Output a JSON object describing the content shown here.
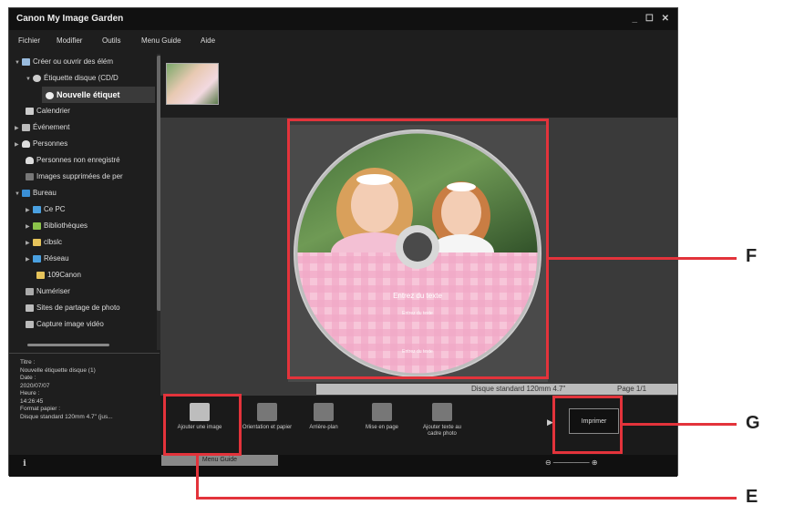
{
  "window": {
    "title": "Canon My Image Garden",
    "controls": "_ ☐ ✕"
  },
  "menu": {
    "items": [
      "Fichier",
      "Modifier",
      "Outils",
      "Menu Guide",
      "Aide"
    ]
  },
  "sidebar": {
    "items": [
      {
        "label": "Créer ou ouvrir des élém",
        "arrow": "▼"
      },
      {
        "label": "Étiquette disque (CD/D",
        "arrow": "▼"
      },
      {
        "label": "Nouvelle étiquet",
        "arrow": ""
      },
      {
        "label": "Calendrier",
        "arrow": ""
      },
      {
        "label": "Événement",
        "arrow": "▶"
      },
      {
        "label": "Personnes",
        "arrow": "▶"
      },
      {
        "label": "Personnes non enregistré",
        "arrow": ""
      },
      {
        "label": "Images supprimées de per",
        "arrow": ""
      },
      {
        "label": "Bureau",
        "arrow": "▼"
      },
      {
        "label": "Ce PC",
        "arrow": "▶"
      },
      {
        "label": "Bibliothèques",
        "arrow": "▶"
      },
      {
        "label": "clbslc",
        "arrow": "▶"
      },
      {
        "label": "Réseau",
        "arrow": "▶"
      },
      {
        "label": "109Canon",
        "arrow": ""
      },
      {
        "label": "Numériser",
        "arrow": ""
      },
      {
        "label": "Sites de partage de photo",
        "arrow": ""
      },
      {
        "label": "Capture image vidéo",
        "arrow": ""
      }
    ]
  },
  "info": {
    "lines": [
      "Titre :",
      "  Nouvelle étiquette disque (1)",
      "Date :",
      "  2020/07/07",
      "Heure :",
      "  14:26:45",
      "Format papier :",
      "  Disque standard 120mm 4.7\" (jus..."
    ]
  },
  "disc": {
    "title": "Entrez du texte",
    "subtitle": "Entrez du texte",
    "footer": "Entrez du texte"
  },
  "statusbar": {
    "paper": "Disque standard 120mm 4.7\"",
    "page": "Page 1/1"
  },
  "toolbar": {
    "items": [
      {
        "label": "Ajouter une image"
      },
      {
        "label": "Orientation et papier"
      },
      {
        "label": "Arrière-plan"
      },
      {
        "label": "Mise en page"
      },
      {
        "label": "Ajouter texte au cadre photo"
      }
    ],
    "print_label": "Imprimer"
  },
  "bottom": {
    "guide_label": "Menu Guide",
    "zoom_controls": "⊖ ─────── ⊕"
  },
  "callouts": {
    "f": "F",
    "g": "G",
    "e": "E"
  },
  "colors": {
    "callout": "#e3333b",
    "disc_pink": "#f2a9c6"
  }
}
